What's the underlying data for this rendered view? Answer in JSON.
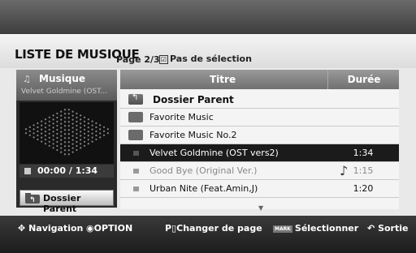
{
  "header": {
    "title": "LISTE DE MUSIQUE",
    "page": "Page 2/3",
    "selection": "Pas de sélection"
  },
  "left_panel": {
    "title": "Musique",
    "now_playing": "Velvet Goldmine (OST...",
    "time": "00:00 / 1:34",
    "parent_button": "Dossier Parent"
  },
  "list": {
    "col_title": "Titre",
    "col_duration": "Durée",
    "rows": [
      {
        "type": "parent",
        "label": "Dossier Parent",
        "duration": ""
      },
      {
        "type": "folder",
        "label": "Favorite Music",
        "duration": ""
      },
      {
        "type": "folder",
        "label": "Favorite Music No.2",
        "duration": ""
      },
      {
        "type": "file",
        "label": "Velvet Goldmine (OST vers2)",
        "duration": "1:34",
        "selected": true
      },
      {
        "type": "file",
        "label": "Good Bye (Original Ver.)",
        "duration": "1:15",
        "dim": true,
        "playing": true
      },
      {
        "type": "file",
        "label": "Urban Nite (Feat.Amin,J)",
        "duration": "1:20"
      }
    ]
  },
  "footer": {
    "navigation": "Navigation",
    "option": "OPTION",
    "page": "Changer de page",
    "mark_key": "MARK",
    "select": "Sélectionner",
    "exit": "Sortie"
  }
}
